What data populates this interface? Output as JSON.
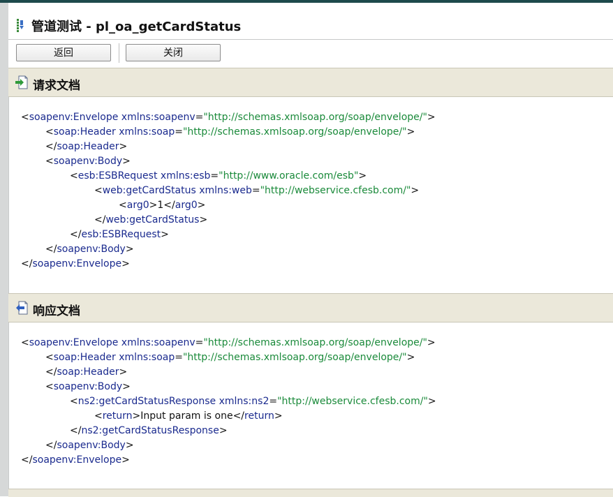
{
  "page": {
    "title": "管道测试 - pl_oa_getCardStatus"
  },
  "toolbar": {
    "back_label": "返回",
    "close_label": "关闭"
  },
  "request": {
    "heading": "请求文档",
    "lines": [
      {
        "indent": 0,
        "parts": [
          [
            "b",
            "<"
          ],
          [
            "t",
            "soapenv:Envelope"
          ],
          [
            "a",
            " xmlns:soapenv"
          ],
          [
            "b",
            "="
          ],
          [
            "v",
            "\"http://schemas.xmlsoap.org/soap/envelope/\""
          ],
          [
            "b",
            ">"
          ]
        ]
      },
      {
        "indent": 1,
        "parts": [
          [
            "b",
            "<"
          ],
          [
            "t",
            "soap:Header"
          ],
          [
            "a",
            " xmlns:soap"
          ],
          [
            "b",
            "="
          ],
          [
            "v",
            "\"http://schemas.xmlsoap.org/soap/envelope/\""
          ],
          [
            "b",
            ">"
          ]
        ]
      },
      {
        "indent": 1,
        "parts": [
          [
            "b",
            "</"
          ],
          [
            "t",
            "soap:Header"
          ],
          [
            "b",
            ">"
          ]
        ]
      },
      {
        "indent": 1,
        "parts": [
          [
            "b",
            "<"
          ],
          [
            "t",
            "soapenv:Body"
          ],
          [
            "b",
            ">"
          ]
        ]
      },
      {
        "indent": 2,
        "parts": [
          [
            "b",
            "<"
          ],
          [
            "t",
            "esb:ESBRequest"
          ],
          [
            "a",
            " xmlns:esb"
          ],
          [
            "b",
            "="
          ],
          [
            "v",
            "\"http://www.oracle.com/esb\""
          ],
          [
            "b",
            ">"
          ]
        ]
      },
      {
        "indent": 3,
        "parts": [
          [
            "b",
            "<"
          ],
          [
            "t",
            "web:getCardStatus"
          ],
          [
            "a",
            " xmlns:web"
          ],
          [
            "b",
            "="
          ],
          [
            "v",
            "\"http://webservice.cfesb.com/\""
          ],
          [
            "b",
            ">"
          ]
        ]
      },
      {
        "indent": 4,
        "parts": [
          [
            "b",
            "<"
          ],
          [
            "t",
            "arg0"
          ],
          [
            "b",
            ">"
          ],
          [
            "txt",
            "1"
          ],
          [
            "b",
            "</"
          ],
          [
            "t",
            "arg0"
          ],
          [
            "b",
            ">"
          ]
        ]
      },
      {
        "indent": 3,
        "parts": [
          [
            "b",
            "</"
          ],
          [
            "t",
            "web:getCardStatus"
          ],
          [
            "b",
            ">"
          ]
        ]
      },
      {
        "indent": 2,
        "parts": [
          [
            "b",
            "</"
          ],
          [
            "t",
            "esb:ESBRequest"
          ],
          [
            "b",
            ">"
          ]
        ]
      },
      {
        "indent": 1,
        "parts": [
          [
            "b",
            "</"
          ],
          [
            "t",
            "soapenv:Body"
          ],
          [
            "b",
            ">"
          ]
        ]
      },
      {
        "indent": 0,
        "parts": [
          [
            "b",
            "</"
          ],
          [
            "t",
            "soapenv:Envelope"
          ],
          [
            "b",
            ">"
          ]
        ]
      }
    ]
  },
  "response": {
    "heading": "响应文档",
    "lines": [
      {
        "indent": 0,
        "parts": [
          [
            "b",
            "<"
          ],
          [
            "t",
            "soapenv:Envelope"
          ],
          [
            "a",
            " xmlns:soapenv"
          ],
          [
            "b",
            "="
          ],
          [
            "v",
            "\"http://schemas.xmlsoap.org/soap/envelope/\""
          ],
          [
            "b",
            ">"
          ]
        ]
      },
      {
        "indent": 1,
        "parts": [
          [
            "b",
            "<"
          ],
          [
            "t",
            "soap:Header"
          ],
          [
            "a",
            " xmlns:soap"
          ],
          [
            "b",
            "="
          ],
          [
            "v",
            "\"http://schemas.xmlsoap.org/soap/envelope/\""
          ],
          [
            "b",
            ">"
          ]
        ]
      },
      {
        "indent": 1,
        "parts": [
          [
            "b",
            "</"
          ],
          [
            "t",
            "soap:Header"
          ],
          [
            "b",
            ">"
          ]
        ]
      },
      {
        "indent": 1,
        "parts": [
          [
            "b",
            "<"
          ],
          [
            "t",
            "soapenv:Body"
          ],
          [
            "b",
            ">"
          ]
        ]
      },
      {
        "indent": 2,
        "parts": [
          [
            "b",
            "<"
          ],
          [
            "t",
            "ns2:getCardStatusResponse"
          ],
          [
            "a",
            " xmlns:ns2"
          ],
          [
            "b",
            "="
          ],
          [
            "v",
            "\"http://webservice.cfesb.com/\""
          ],
          [
            "b",
            ">"
          ]
        ]
      },
      {
        "indent": 3,
        "parts": [
          [
            "b",
            "<"
          ],
          [
            "t",
            "return"
          ],
          [
            "b",
            ">"
          ],
          [
            "txt",
            "Input param is one"
          ],
          [
            "b",
            "</"
          ],
          [
            "t",
            "return"
          ],
          [
            "b",
            ">"
          ]
        ]
      },
      {
        "indent": 2,
        "parts": [
          [
            "b",
            "</"
          ],
          [
            "t",
            "ns2:getCardStatusResponse"
          ],
          [
            "b",
            ">"
          ]
        ]
      },
      {
        "indent": 1,
        "parts": [
          [
            "b",
            "</"
          ],
          [
            "t",
            "soapenv:Body"
          ],
          [
            "b",
            ">"
          ]
        ]
      },
      {
        "indent": 0,
        "parts": [
          [
            "b",
            "</"
          ],
          [
            "t",
            "soapenv:Envelope"
          ],
          [
            "b",
            ">"
          ]
        ]
      }
    ]
  },
  "colors": {
    "tag": "#1a2a8e",
    "value": "#1a8a3a",
    "section_bg": "#ebe8da",
    "topbar": "#1e4a4c"
  },
  "icons": {
    "title": "pipeline-icon",
    "request": "request-arrow-icon",
    "response": "response-arrow-icon"
  }
}
